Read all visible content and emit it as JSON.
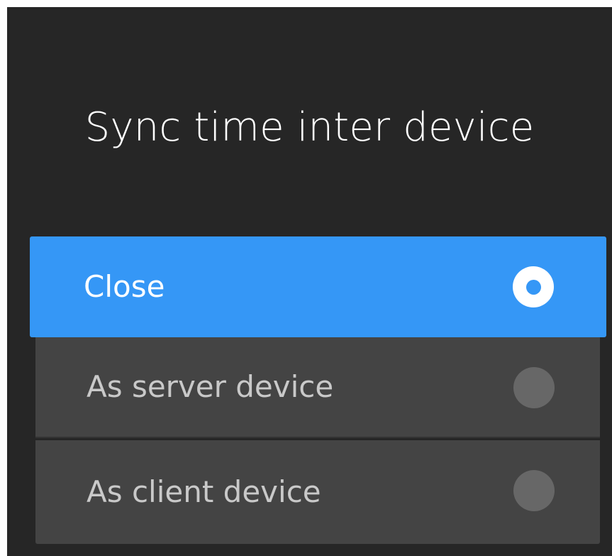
{
  "dialog": {
    "title": "Sync time inter device"
  },
  "options": [
    {
      "label": "Close",
      "selected": true
    },
    {
      "label": "As server device",
      "selected": false
    },
    {
      "label": "As client device",
      "selected": false
    }
  ],
  "colors": {
    "background": "#262626",
    "selected_background": "#3597f6",
    "option_background": "#444444",
    "selected_text": "#ffffff",
    "unselected_text": "#c9c9c9",
    "unselected_radio": "#676767"
  },
  "icons": {
    "selected_radio": "radio-selected-icon",
    "unselected_radio": "radio-unselected-icon"
  }
}
